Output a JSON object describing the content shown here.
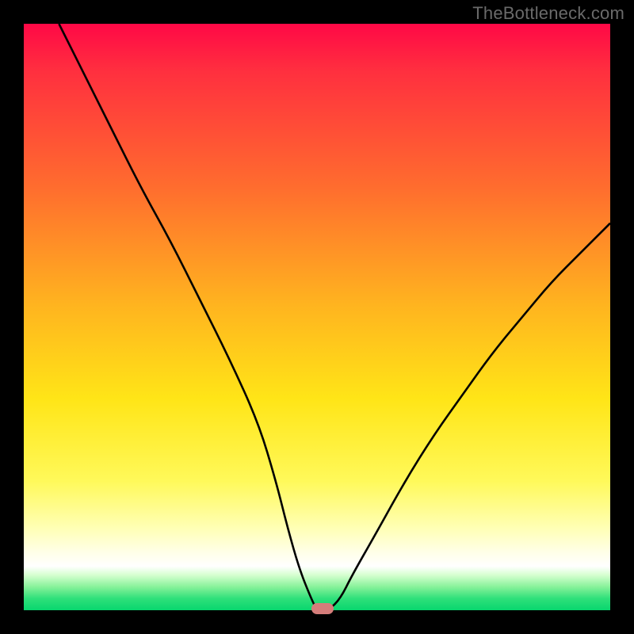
{
  "watermark": "TheBottleneck.com",
  "colors": {
    "frame": "#000000",
    "curve": "#000000",
    "marker": "#d57d7a",
    "watermark_text": "#6a6a6a",
    "gradient_stops": [
      "#ff0846",
      "#ff2f3f",
      "#ff6d2e",
      "#ffb41f",
      "#ffe517",
      "#fff95a",
      "#ffffb5",
      "#ffffe6",
      "#ffffff",
      "#d6ffd0",
      "#88f29a",
      "#2fe07a",
      "#08d66e"
    ]
  },
  "chart_data": {
    "type": "line",
    "title": "",
    "xlabel": "",
    "ylabel": "",
    "ylim": [
      0,
      100
    ],
    "xlim": [
      0,
      100
    ],
    "series": [
      {
        "name": "bottleneck-curve",
        "x": [
          6,
          10,
          15,
          20,
          25,
          30,
          35,
          40,
          43,
          45,
          47,
          49,
          50,
          52,
          54,
          56,
          60,
          65,
          70,
          75,
          80,
          85,
          90,
          95,
          100
        ],
        "values": [
          100,
          92,
          82,
          72,
          63,
          53,
          43,
          32,
          22,
          14,
          7,
          2,
          0,
          0,
          2,
          6,
          13,
          22,
          30,
          37,
          44,
          50,
          56,
          61,
          66
        ]
      }
    ],
    "marker": {
      "x": 51,
      "y": 0
    },
    "background": "severity-gradient-red-to-green"
  }
}
